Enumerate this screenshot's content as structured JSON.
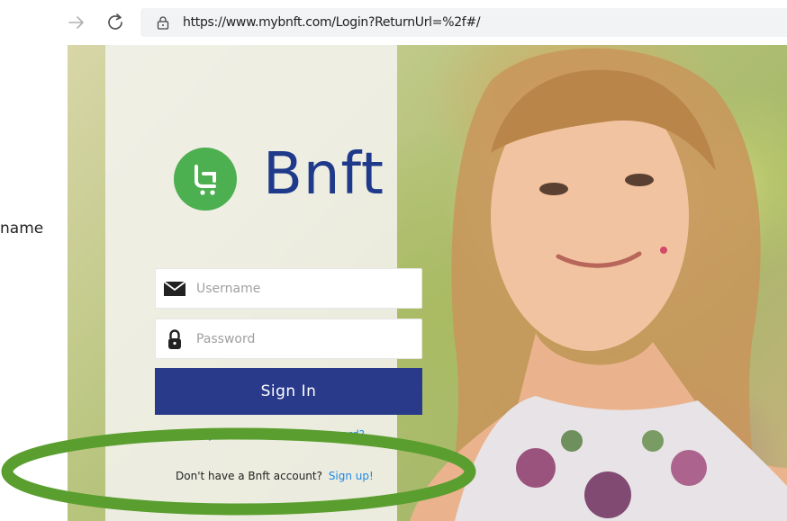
{
  "browser": {
    "url": "https://www.mybnft.com/Login?ReturnUrl=%2f#/"
  },
  "left_label": "name",
  "brand": {
    "name": "Bnft",
    "color": "#1f3a8a",
    "logo_color": "#4caf50"
  },
  "login": {
    "username_placeholder": "Username",
    "password_placeholder": "Password",
    "signin_label": "Sign In",
    "signin_color": "#293a8a",
    "forgot_text": "Forgot your username or password?",
    "no_account_text": "Don't have a Bnft account?",
    "signup_label": "Sign up!",
    "link_color": "#1e88e5"
  },
  "annotation": {
    "color": "#5a9e2f",
    "shape": "ellipse"
  }
}
